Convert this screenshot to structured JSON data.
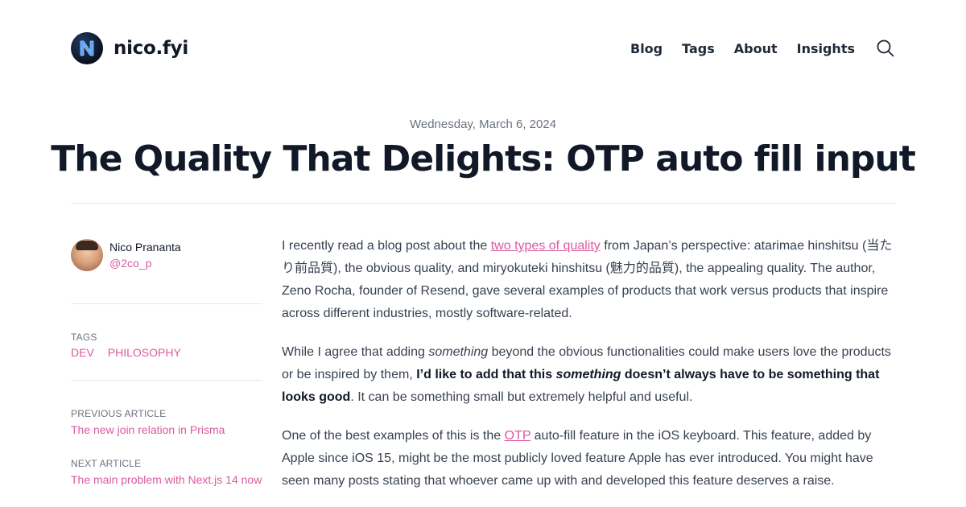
{
  "site": {
    "name": "nico.fyi"
  },
  "nav": [
    {
      "label": "Blog"
    },
    {
      "label": "Tags"
    },
    {
      "label": "About"
    },
    {
      "label": "Insights"
    }
  ],
  "post": {
    "date": "Wednesday, March 6, 2024",
    "title": "The Quality That Delights: OTP auto fill input"
  },
  "author": {
    "name": "Nico Prananta",
    "handle": "@2co_p"
  },
  "tags": {
    "label": "Tags",
    "items": [
      "dev",
      "philosophy"
    ]
  },
  "previous": {
    "label": "Previous Article",
    "title": "The new join relation in Prisma"
  },
  "next": {
    "label": "Next Article",
    "title": "The main problem with Next.js 14 now"
  },
  "article": {
    "p1": {
      "before": "I recently read a blog post about the ",
      "link": "two types of quality",
      "after": " from Japan’s perspective: atarimae hinshitsu (当たり前品質), the obvious quality, and miryokuteki hinshitsu (魅力的品質), the appealing quality. The author, Zeno Rocha, founder of Resend, gave several examples of products that work versus products that inspire across different industries, mostly software-related."
    },
    "p2": {
      "a": "While I agree that adding ",
      "em1": "something",
      "b": " beyond the obvious functionalities could make users love the products or be inspired by them, ",
      "strong_a": "I’d like to add that this ",
      "strong_em": "something",
      "strong_b": " doesn’t always have to be something that looks good",
      "c": ". It can be something small but extremely helpful and useful."
    },
    "p3": {
      "a": "One of the best examples of this is the ",
      "link": "OTP",
      "b": " auto-fill feature in the iOS keyboard. This feature, added by Apple since iOS 15, might be the most publicly loved feature Apple has ever introduced. You might have seen many posts stating that whoever came up with and developed this feature deserves a raise."
    }
  },
  "colors": {
    "accent": "#db5a9f",
    "text": "#374151",
    "heading": "#111827",
    "muted": "#6b7280",
    "rule": "#e5e7eb"
  }
}
